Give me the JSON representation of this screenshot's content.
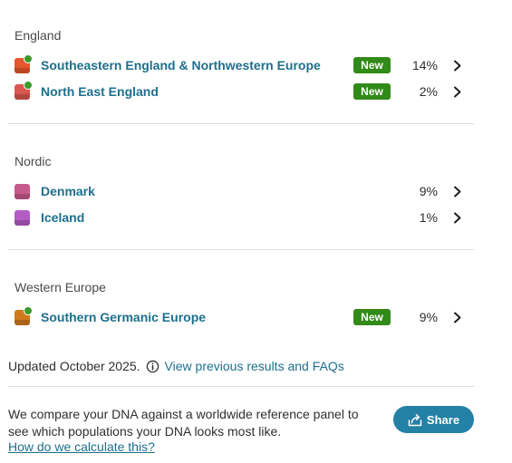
{
  "groups": [
    {
      "title": "England",
      "regions": [
        {
          "name": "Southeastern England & Northwestern Europe",
          "badge": "New",
          "percent": "14%",
          "color": "#e4572e",
          "is_new": true
        },
        {
          "name": "North East England",
          "badge": "New",
          "percent": "2%",
          "color": "#d9574f",
          "is_new": true
        }
      ]
    },
    {
      "title": "Nordic",
      "regions": [
        {
          "name": "Denmark",
          "badge": "",
          "percent": "9%",
          "color": "#c75a8a",
          "is_new": false
        },
        {
          "name": "Iceland",
          "badge": "",
          "percent": "1%",
          "color": "#b35cc4",
          "is_new": false
        }
      ]
    },
    {
      "title": "Western Europe",
      "regions": [
        {
          "name": "Southern Germanic Europe",
          "badge": "New",
          "percent": "9%",
          "color": "#d07a1d",
          "is_new": true
        }
      ]
    }
  ],
  "footer": {
    "updated_text": "Updated October 2025.",
    "previous_link": "View previous results and FAQs",
    "explanation": "We compare your DNA against a worldwide reference panel to see which populations your DNA looks most like.",
    "how_link": "How do we calculate this?",
    "share_label": "Share"
  },
  "colors": {
    "link": "#1d6f8e",
    "new_badge": "#328a18",
    "new_dot": "#3c9a2b",
    "share_button": "#2381a6"
  },
  "icons": {
    "chevron": "chevron-right-icon",
    "info": "info-icon",
    "share": "share-icon"
  }
}
